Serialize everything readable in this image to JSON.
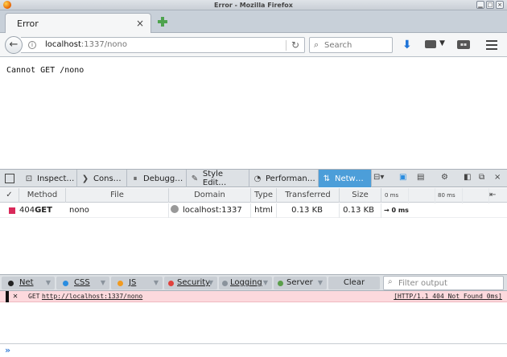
{
  "window": {
    "title": "Error - Mozilla Firefox"
  },
  "tab": {
    "title": "Error"
  },
  "navbar": {
    "url_host": "localhost",
    "url_rest": ":1337/nono",
    "search_placeholder": "Search"
  },
  "page": {
    "text": "Cannot GET /nono"
  },
  "devtools": {
    "tabs": [
      {
        "label": "Inspect…",
        "icon": "inspector-icon"
      },
      {
        "label": "Cons…",
        "icon": "console-icon"
      },
      {
        "label": "Debugg…",
        "icon": "debugger-icon"
      },
      {
        "label": "Style Edit…",
        "icon": "style-editor-icon"
      },
      {
        "label": "Performan…",
        "icon": "performance-icon"
      },
      {
        "label": "Netw…",
        "icon": "network-icon",
        "active": true
      }
    ],
    "accent_color": "#4c9ed9"
  },
  "network": {
    "columns": {
      "check": "✓",
      "method": "Method",
      "file": "File",
      "domain": "Domain",
      "type": "Type",
      "transferred": "Transferred",
      "size": "Size",
      "t0": "0 ms",
      "t80": "80 ms"
    },
    "rows": [
      {
        "status": "404",
        "method": "GET",
        "file": "nono",
        "domain": "localhost:1337",
        "type": "html",
        "transferred": "0.13 KB",
        "size": "0.13 KB",
        "timing": "→ 0 ms",
        "status_color": "#d9295a"
      }
    ]
  },
  "console": {
    "filters": [
      {
        "label": "Net",
        "color": "#222222"
      },
      {
        "label": "CSS",
        "color": "#2a8de0"
      },
      {
        "label": "JS",
        "color": "#f19a1f"
      },
      {
        "label": "Security",
        "color": "#e0413c"
      },
      {
        "label": "Logging",
        "color": "#8a939c"
      },
      {
        "label": "Server",
        "color": "#5a9e4a"
      }
    ],
    "clear_label": "Clear",
    "filter_placeholder": "Filter output",
    "message": {
      "method": "GET",
      "url": "http://localhost:1337/nono",
      "status": "[HTTP/1.1 404 Not Found 0ms]"
    },
    "prompt": "»"
  }
}
